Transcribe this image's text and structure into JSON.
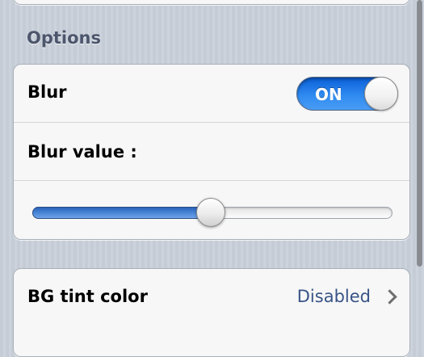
{
  "options": {
    "section_title": "Options",
    "blur": {
      "label": "Blur",
      "toggle": {
        "state_label": "ON",
        "on": true
      }
    },
    "blur_value": {
      "label": "Blur value :",
      "slider": {
        "value": 0.495,
        "min": 0,
        "max": 1
      }
    }
  },
  "background": {
    "tint_color": {
      "label": "BG tint color",
      "value": "Disabled",
      "accessory_icon": "chevron-right-icon"
    }
  },
  "colors": {
    "accent": "#2f8af0",
    "detail_text": "#385487",
    "section_header": "#4c566c"
  }
}
